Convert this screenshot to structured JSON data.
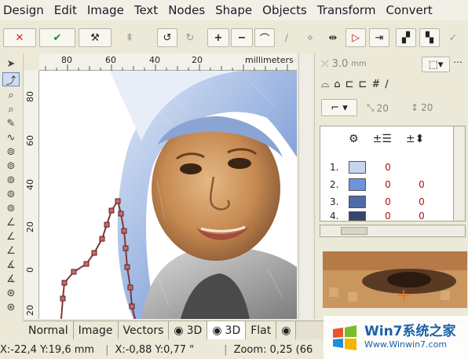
{
  "menu": [
    "Design",
    "Edit",
    "Image",
    "Text",
    "Nodes",
    "Shape",
    "Objects",
    "Transform",
    "Convert"
  ],
  "ruler": {
    "top_ticks": [
      "80",
      "60",
      "40",
      "20",
      "millimeters"
    ],
    "left_ticks": [
      "80",
      "60",
      "40",
      "20",
      "0",
      "20"
    ]
  },
  "panel": {
    "stitch_width": "3.0",
    "stitch_unit": "mm",
    "val_a": "20",
    "val_b": "20",
    "threads": [
      {
        "num": "1.",
        "a": "0",
        "b": "",
        "color": "#c7d5ef"
      },
      {
        "num": "2.",
        "a": "0",
        "b": "0",
        "color": "#6d95dc"
      },
      {
        "num": "3.",
        "a": "0",
        "b": "0",
        "color": "#4d6da6"
      },
      {
        "num": "4.",
        "a": "0",
        "b": "0",
        "color": "#34476d"
      }
    ]
  },
  "tabs": [
    "Normal",
    "Image",
    "Vectors",
    "3D",
    "3D",
    "Flat"
  ],
  "status": {
    "pos": "X:-22,4 Y:19,6 mm",
    "delta": "X:-0,88 Y:0,77 \"",
    "zoom": "Zoom: 0,25 (66"
  },
  "watermark": {
    "brand": "Win7系统之家",
    "url": "Www.Winwin7.com"
  },
  "colors": {
    "thread_red": "#b01010",
    "selection": "#cfdcf2"
  }
}
